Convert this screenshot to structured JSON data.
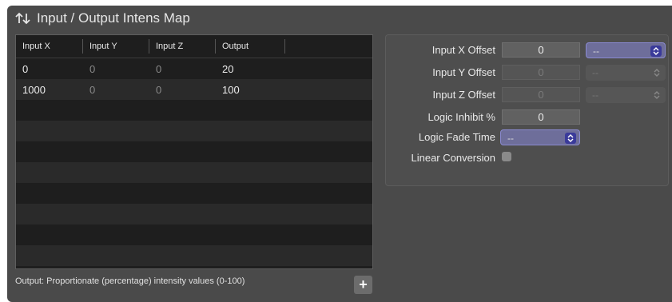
{
  "panel": {
    "title": "Input / Output Intens Map"
  },
  "table": {
    "columns": [
      "Input X",
      "Input Y",
      "Input Z",
      "Output"
    ],
    "rows": [
      [
        "0",
        "0",
        "0",
        "20"
      ],
      [
        "1000",
        "0",
        "0",
        "100"
      ]
    ]
  },
  "footer": {
    "note": "Output: Proportionate (percentage) intensity values (0-100)",
    "add_label": "+"
  },
  "settings": {
    "input_x_offset": {
      "label": "Input X Offset",
      "value": "0",
      "select": "--"
    },
    "input_y_offset": {
      "label": "Input Y Offset",
      "value": "0",
      "select": "--"
    },
    "input_z_offset": {
      "label": "Input Z Offset",
      "value": "0",
      "select": "--"
    },
    "logic_inhibit": {
      "label": "Logic Inhibit %",
      "value": "0"
    },
    "logic_fade_time": {
      "label": "Logic Fade Time",
      "select": "--"
    },
    "linear_conversion": {
      "label": "Linear Conversion",
      "checked": false
    }
  }
}
